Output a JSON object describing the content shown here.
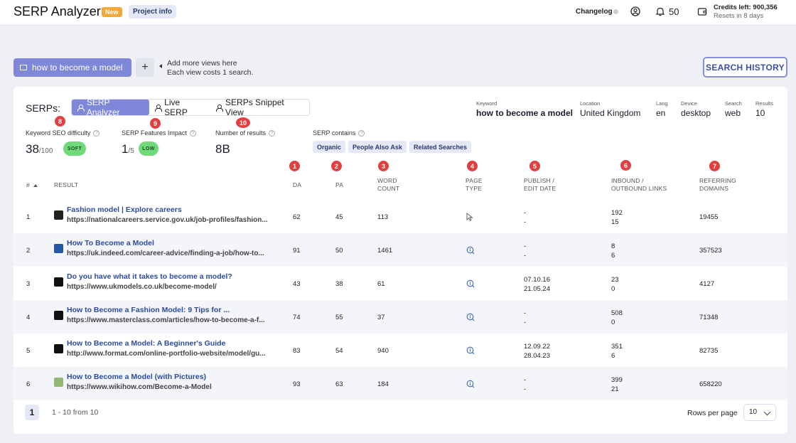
{
  "app": {
    "title": "SERP Analyzer",
    "badge": "New",
    "project_info": "Project info"
  },
  "topbar": {
    "changelog": "Changelog",
    "notifications": "50",
    "credits": "Credits left: 900,356",
    "resets": "Resets in 8 days"
  },
  "views": {
    "active_tab": "how to become a model",
    "add": "+",
    "hint_line1": "Add more views here",
    "hint_line2": "Each view costs 1 search."
  },
  "search_history": "SEARCH HISTORY",
  "serps": {
    "label": "SERPs:",
    "modes": [
      "SERP Analyzer",
      "Live SERP",
      "SERPs Snippet View"
    ],
    "meta": {
      "keyword_label": "Keyword",
      "keyword": "how to become a model",
      "location_label": "Location",
      "location": "United Kingdom",
      "lang_label": "Lang",
      "lang": "en",
      "device_label": "Device",
      "device": "desktop",
      "search_label": "Search",
      "search": "web",
      "results_label": "Results",
      "results": "10"
    }
  },
  "stats": {
    "kd_label": "Keyword SEO difficulty",
    "kd_value": "38",
    "kd_max": "/100",
    "kd_badge": "SOFT",
    "sfi_label": "SERP Features Impact",
    "sfi_value": "1",
    "sfi_max": "/5",
    "sfi_badge": "LOW",
    "nr_label": "Number of results",
    "nr_value": "8B",
    "contains_label": "SERP contains",
    "contains": [
      "Organic",
      "People Also Ask",
      "Related Searches"
    ]
  },
  "markers": [
    "1",
    "2",
    "3",
    "4",
    "5",
    "6",
    "7",
    "8",
    "9",
    "10"
  ],
  "columns": {
    "rank": "#",
    "result": "RESULT",
    "da": "DA",
    "pa": "PA",
    "word_count_1": "WORD",
    "word_count_2": "COUNT",
    "page_type_1": "PAGE",
    "page_type_2": "TYPE",
    "date_1": "PUBLISH /",
    "date_2": "EDIT DATE",
    "links_1": "INBOUND /",
    "links_2": "OUTBOUND LINKS",
    "ref_1": "REFERRING",
    "ref_2": "DOMAINS"
  },
  "rows": [
    {
      "rank": "1",
      "title": "Fashion model | Explore careers",
      "url": "https://nationalcareers.service.gov.uk/job-profiles/fashion...",
      "da": "62",
      "pa": "45",
      "words": "113",
      "type_icon": "cursor-icon",
      "date1": "-",
      "date2": "-",
      "inbound": "192",
      "outbound": "15",
      "ref": "19455",
      "favicon_color": "#222222"
    },
    {
      "rank": "2",
      "title": "How To Become a Model",
      "url": "https://uk.indeed.com/career-advice/finding-a-job/how-to...",
      "da": "91",
      "pa": "50",
      "words": "1461",
      "type_icon": "info-search-icon",
      "date1": "-",
      "date2": "-",
      "inbound": "8",
      "outbound": "6",
      "ref": "357523",
      "favicon_color": "#2557a7"
    },
    {
      "rank": "3",
      "title": "Do you have what it takes to become a model?",
      "url": "https://www.ukmodels.co.uk/become-model/",
      "da": "43",
      "pa": "38",
      "words": "61",
      "type_icon": "info-search-icon",
      "date1": "07.10.16",
      "date2": "21.05.24",
      "inbound": "23",
      "outbound": "0",
      "ref": "4127",
      "favicon_color": "#111111"
    },
    {
      "rank": "4",
      "title": "How to Become a Fashion Model: 9 Tips for ...",
      "url": "https://www.masterclass.com/articles/how-to-become-a-f...",
      "da": "74",
      "pa": "55",
      "words": "37",
      "type_icon": "info-search-icon",
      "date1": "-",
      "date2": "-",
      "inbound": "508",
      "outbound": "0",
      "ref": "71348",
      "favicon_color": "#111111"
    },
    {
      "rank": "5",
      "title": "How to Become a Model: A Beginner's Guide",
      "url": "http://www.format.com/online-portfolio-website/model/gu...",
      "da": "83",
      "pa": "54",
      "words": "940",
      "type_icon": "info-search-icon",
      "date1": "12.09.22",
      "date2": "28.04.23",
      "inbound": "351",
      "outbound": "6",
      "ref": "82735",
      "favicon_color": "#111111"
    },
    {
      "rank": "6",
      "title": "How to Become a Model (with Pictures)",
      "url": "https://www.wikihow.com/Become-a-Model",
      "da": "93",
      "pa": "63",
      "words": "184",
      "type_icon": "info-search-icon",
      "date1": "-",
      "date2": "-",
      "inbound": "399",
      "outbound": "21",
      "ref": "658220",
      "favicon_color": "#93b874"
    }
  ],
  "pagination": {
    "page": "1",
    "info": "1 - 10 from 10",
    "rows_label": "Rows per page",
    "rows_value": "10"
  }
}
